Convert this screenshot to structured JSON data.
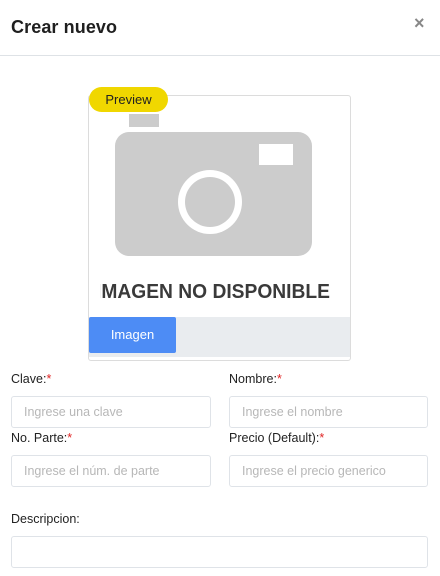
{
  "modal": {
    "title": "Crear nuevo",
    "close_symbol": "×"
  },
  "preview": {
    "badge_label": "Preview",
    "placeholder_text": "IMAGEN NO DISPONIBLE",
    "placeholder_icon": "camera-icon",
    "upload_button_label": "Imagen",
    "colors": {
      "badge": "#f0d700",
      "upload_button": "#4d8cf5",
      "camera_fill": "#cccccc"
    }
  },
  "form": {
    "clave": {
      "label": "Clave:",
      "required_mark": "*",
      "placeholder": "Ingrese una clave",
      "value": ""
    },
    "nombre": {
      "label": "Nombre:",
      "required_mark": "*",
      "placeholder": "Ingrese el nombre",
      "value": ""
    },
    "no_parte": {
      "label": "No. Parte:",
      "required_mark": "*",
      "placeholder": "Ingrese el núm. de parte",
      "value": ""
    },
    "precio": {
      "label": "Precio (Default):",
      "required_mark": "*",
      "placeholder": "Ingrese el precio generico",
      "value": ""
    },
    "descripcion": {
      "label": "Descripcion:",
      "placeholder": "",
      "value": ""
    }
  }
}
